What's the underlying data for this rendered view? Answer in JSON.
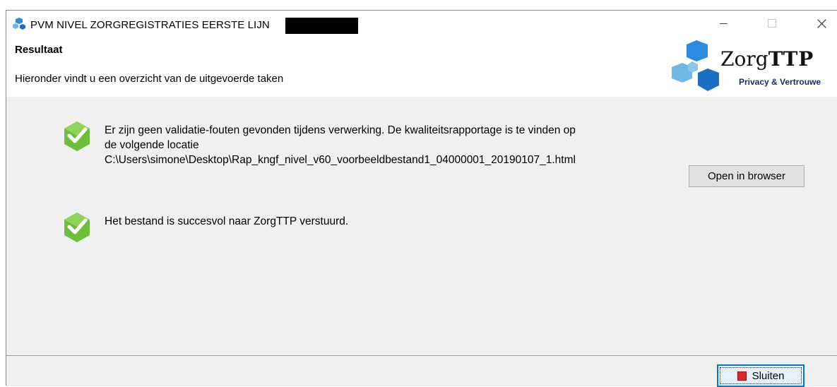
{
  "window": {
    "title": "PVM NIVEL ZORGREGISTRATIES EERSTE LIJN",
    "controls": {
      "minimize": "minimize-icon",
      "maximize": "maximize-icon",
      "close": "close-icon"
    }
  },
  "header": {
    "title": "Resultaat",
    "subtitle": "Hieronder vindt u een overzicht van de uitgevoerde taken",
    "logo": {
      "name_regular": "Zorg",
      "name_bold": "TTP",
      "tagline": "Privacy & Vertrouwe"
    }
  },
  "results": [
    {
      "icon": "check-shield-icon",
      "text_line1": "Er zijn geen validatie-fouten gevonden tijdens verwerking. De kwaliteitsrapportage is te vinden op",
      "text_line2": "de volgende locatie",
      "path": "C:\\Users\\simone\\Desktop\\Rap_kngf_nivel_v60_voorbeeldbestand1_04000001_20190107_1.html",
      "button": "Open in browser"
    },
    {
      "icon": "check-shield-icon",
      "text": "Het bestand is succesvol naar ZorgTTP verstuurd."
    }
  ],
  "footer": {
    "close_button": "Sluiten"
  },
  "colors": {
    "accent": "#0078d7",
    "check_green": "#6cbf3b",
    "logo_blue": "#1a7ad2",
    "logo_light_blue": "#6fb8e6",
    "panel_bg": "#f0f0f0"
  }
}
